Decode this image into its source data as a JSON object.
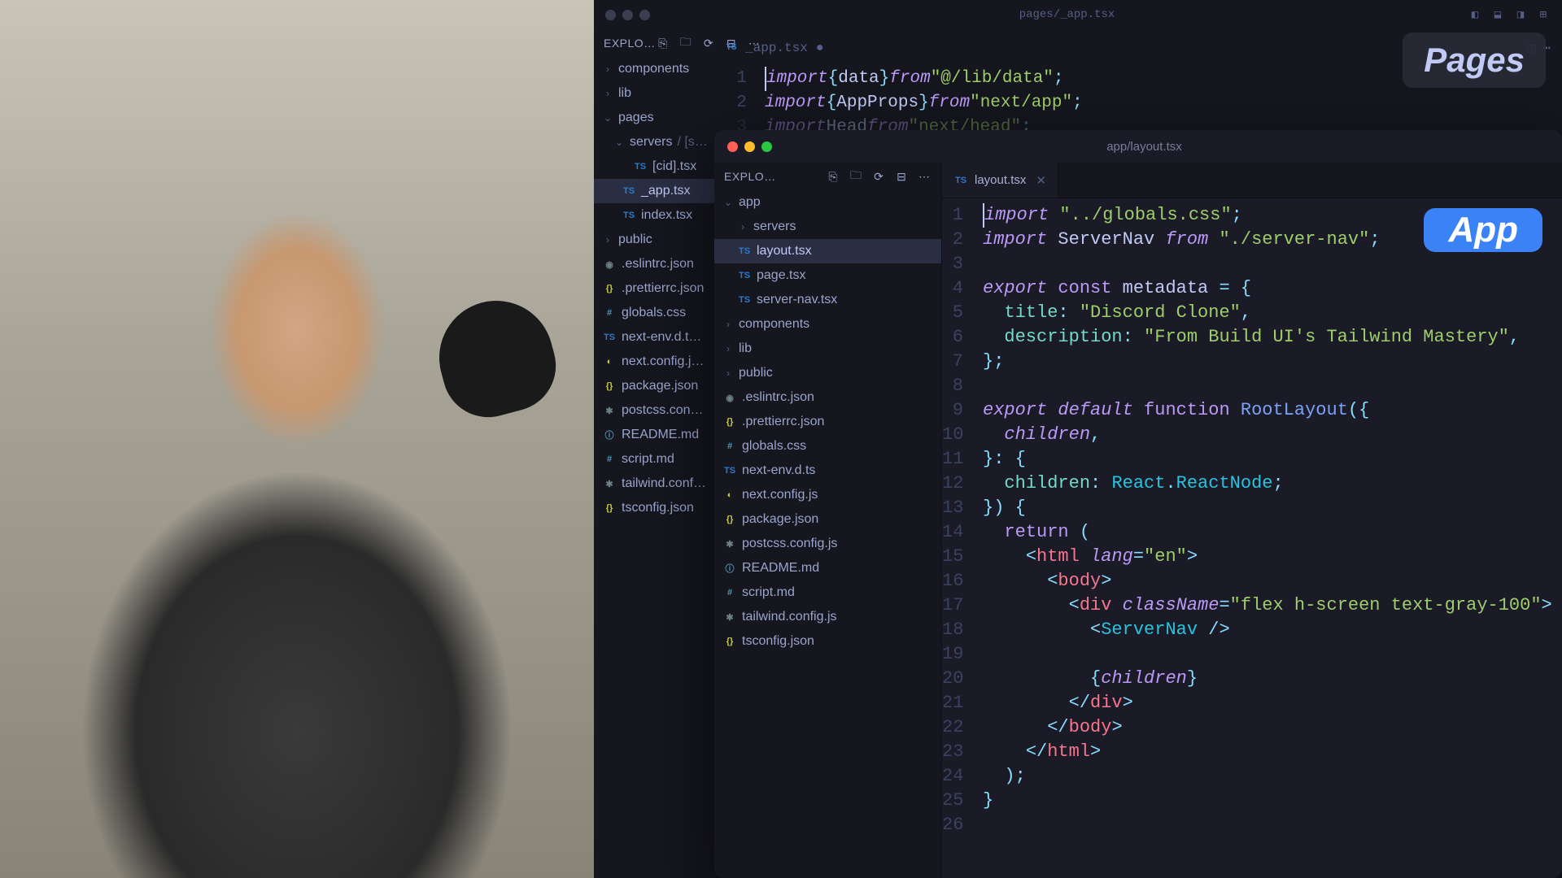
{
  "badges": {
    "pages": "Pages",
    "app": "App"
  },
  "bg": {
    "title": "pages/_app.tsx",
    "explorer": "EXPLO…",
    "tab_file": "_app.tsx",
    "tree": {
      "components": "components",
      "lib": "lib",
      "pages": "pages",
      "servers": "servers",
      "servers_path": " / [s…",
      "cid": "[cid].tsx",
      "app": "_app.tsx",
      "index": "index.tsx",
      "public": "public",
      "eslint": ".eslintrc.json",
      "prettier": ".prettierrc.json",
      "globals": "globals.css",
      "nextenv": "next-env.d.t…",
      "nextconfig": "next.config.j…",
      "package": "package.json",
      "postcss": "postcss.con…",
      "readme": "README.md",
      "script": "script.md",
      "tailwind": "tailwind.conf…",
      "tsconfig": "tsconfig.json"
    },
    "code": {
      "l1": {
        "kw": "import",
        "o1": " { ",
        "id": "data",
        "o2": " } ",
        "from": "from ",
        "str": "\"@/lib/data\"",
        "end": ";"
      },
      "l2": {
        "kw": "import",
        "o1": " { ",
        "id": "AppProps",
        "o2": " } ",
        "from": "from ",
        "str": "\"next/app\"",
        "end": ";"
      },
      "l3": {
        "kw": "import",
        "sp": " ",
        "id": "Head",
        "sp2": " ",
        "from": "from ",
        "str": "\"next/head\"",
        "end": ";"
      }
    }
  },
  "fg": {
    "title": "app/layout.tsx",
    "explorer": "EXPLO…",
    "tab_file": "layout.tsx",
    "tree": {
      "app": "app",
      "servers": "servers",
      "layout": "layout.tsx",
      "page": "page.tsx",
      "servernav": "server-nav.tsx",
      "components": "components",
      "lib": "lib",
      "public": "public",
      "eslint": ".eslintrc.json",
      "prettier": ".prettierrc.json",
      "globals": "globals.css",
      "nextenv": "next-env.d.ts",
      "nextconfig": "next.config.js",
      "package": "package.json",
      "postcss": "postcss.config.js",
      "readme": "README.md",
      "script": "script.md",
      "tailwind": "tailwind.config.js",
      "tsconfig": "tsconfig.json"
    },
    "code": [
      [
        {
          "c": "k",
          "t": "import"
        },
        {
          "c": "p",
          "t": " "
        },
        {
          "c": "s",
          "t": "\"../globals.css\""
        },
        {
          "c": "o",
          "t": ";"
        }
      ],
      [
        {
          "c": "k",
          "t": "import"
        },
        {
          "c": "p",
          "t": " "
        },
        {
          "c": "n",
          "t": "ServerNav"
        },
        {
          "c": "p",
          "t": " "
        },
        {
          "c": "k",
          "t": "from"
        },
        {
          "c": "p",
          "t": " "
        },
        {
          "c": "s",
          "t": "\"./server-nav\""
        },
        {
          "c": "o",
          "t": ";"
        }
      ],
      [],
      [
        {
          "c": "k",
          "t": "export"
        },
        {
          "c": "p",
          "t": " "
        },
        {
          "c": "kf",
          "t": "const"
        },
        {
          "c": "p",
          "t": " "
        },
        {
          "c": "n",
          "t": "metadata"
        },
        {
          "c": "p",
          "t": " "
        },
        {
          "c": "o",
          "t": "="
        },
        {
          "c": "p",
          "t": " "
        },
        {
          "c": "o",
          "t": "{"
        }
      ],
      [
        {
          "c": "p",
          "t": "  "
        },
        {
          "c": "pr",
          "t": "title"
        },
        {
          "c": "o",
          "t": ":"
        },
        {
          "c": "p",
          "t": " "
        },
        {
          "c": "s",
          "t": "\"Discord Clone\""
        },
        {
          "c": "o",
          "t": ","
        }
      ],
      [
        {
          "c": "p",
          "t": "  "
        },
        {
          "c": "pr",
          "t": "description"
        },
        {
          "c": "o",
          "t": ":"
        },
        {
          "c": "p",
          "t": " "
        },
        {
          "c": "s",
          "t": "\"From Build UI's Tailwind Mastery\""
        },
        {
          "c": "o",
          "t": ","
        }
      ],
      [
        {
          "c": "o",
          "t": "};"
        }
      ],
      [],
      [
        {
          "c": "k",
          "t": "export"
        },
        {
          "c": "p",
          "t": " "
        },
        {
          "c": "k",
          "t": "default"
        },
        {
          "c": "p",
          "t": " "
        },
        {
          "c": "kf",
          "t": "function"
        },
        {
          "c": "p",
          "t": " "
        },
        {
          "c": "fn",
          "t": "RootLayout"
        },
        {
          "c": "o",
          "t": "({"
        }
      ],
      [
        {
          "c": "p",
          "t": "  "
        },
        {
          "c": "at",
          "t": "children"
        },
        {
          "c": "o",
          "t": ","
        }
      ],
      [
        {
          "c": "o",
          "t": "}"
        },
        {
          "c": "o",
          "t": ":"
        },
        {
          "c": "p",
          "t": " "
        },
        {
          "c": "o",
          "t": "{"
        }
      ],
      [
        {
          "c": "p",
          "t": "  "
        },
        {
          "c": "pr",
          "t": "children"
        },
        {
          "c": "o",
          "t": ":"
        },
        {
          "c": "p",
          "t": " "
        },
        {
          "c": "ty",
          "t": "React"
        },
        {
          "c": "o",
          "t": "."
        },
        {
          "c": "ty",
          "t": "ReactNode"
        },
        {
          "c": "o",
          "t": ";"
        }
      ],
      [
        {
          "c": "o",
          "t": "})"
        },
        {
          "c": "p",
          "t": " "
        },
        {
          "c": "o",
          "t": "{"
        }
      ],
      [
        {
          "c": "p",
          "t": "  "
        },
        {
          "c": "kf",
          "t": "return"
        },
        {
          "c": "p",
          "t": " "
        },
        {
          "c": "o",
          "t": "("
        }
      ],
      [
        {
          "c": "p",
          "t": "    "
        },
        {
          "c": "o",
          "t": "<"
        },
        {
          "c": "tg",
          "t": "html"
        },
        {
          "c": "p",
          "t": " "
        },
        {
          "c": "at",
          "t": "lang"
        },
        {
          "c": "o",
          "t": "="
        },
        {
          "c": "s",
          "t": "\"en\""
        },
        {
          "c": "o",
          "t": ">"
        }
      ],
      [
        {
          "c": "p",
          "t": "      "
        },
        {
          "c": "o",
          "t": "<"
        },
        {
          "c": "tg",
          "t": "body"
        },
        {
          "c": "o",
          "t": ">"
        }
      ],
      [
        {
          "c": "p",
          "t": "        "
        },
        {
          "c": "o",
          "t": "<"
        },
        {
          "c": "tg",
          "t": "div"
        },
        {
          "c": "p",
          "t": " "
        },
        {
          "c": "at",
          "t": "className"
        },
        {
          "c": "o",
          "t": "="
        },
        {
          "c": "s",
          "t": "\"flex h-screen text-gray-100\""
        },
        {
          "c": "o",
          "t": ">"
        }
      ],
      [
        {
          "c": "p",
          "t": "          "
        },
        {
          "c": "o",
          "t": "<"
        },
        {
          "c": "ty",
          "t": "ServerNav"
        },
        {
          "c": "p",
          "t": " "
        },
        {
          "c": "o",
          "t": "/>"
        }
      ],
      [],
      [
        {
          "c": "p",
          "t": "          "
        },
        {
          "c": "o",
          "t": "{"
        },
        {
          "c": "at",
          "t": "children"
        },
        {
          "c": "o",
          "t": "}"
        }
      ],
      [
        {
          "c": "p",
          "t": "        "
        },
        {
          "c": "o",
          "t": "</"
        },
        {
          "c": "tg",
          "t": "div"
        },
        {
          "c": "o",
          "t": ">"
        }
      ],
      [
        {
          "c": "p",
          "t": "      "
        },
        {
          "c": "o",
          "t": "</"
        },
        {
          "c": "tg",
          "t": "body"
        },
        {
          "c": "o",
          "t": ">"
        }
      ],
      [
        {
          "c": "p",
          "t": "    "
        },
        {
          "c": "o",
          "t": "</"
        },
        {
          "c": "tg",
          "t": "html"
        },
        {
          "c": "o",
          "t": ">"
        }
      ],
      [
        {
          "c": "p",
          "t": "  "
        },
        {
          "c": "o",
          "t": ");"
        }
      ],
      [
        {
          "c": "o",
          "t": "}"
        }
      ],
      []
    ]
  }
}
